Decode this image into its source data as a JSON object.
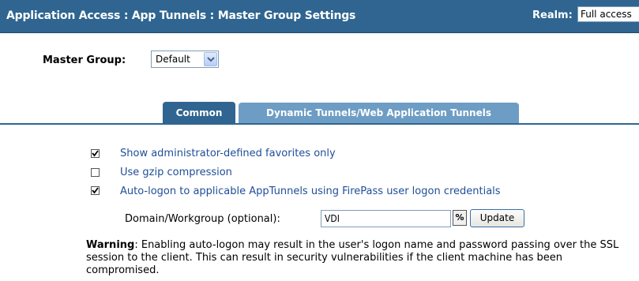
{
  "header": {
    "title": "Application Access : App Tunnels : Master Group Settings",
    "realm_label": "Realm:",
    "realm_value": "Full access"
  },
  "master_group": {
    "label": "Master Group:",
    "value": "Default"
  },
  "tabs": [
    {
      "label": "Common",
      "active": true
    },
    {
      "label": "Dynamic Tunnels/Web Application Tunnels",
      "active": false
    }
  ],
  "options": [
    {
      "label": "Show administrator-defined favorites only",
      "checked": true
    },
    {
      "label": "Use gzip compression",
      "checked": false
    },
    {
      "label": "Auto-logon to applicable AppTunnels using FirePass user logon credentials",
      "checked": true
    }
  ],
  "domain": {
    "label": "Domain/Workgroup (optional):",
    "value": "VDI",
    "percent_label": "%",
    "update_label": "Update"
  },
  "warning": {
    "prefix": "Warning",
    "text": ": Enabling auto-logon may result in the user's logon name and password passing over the SSL session to the client. This can result in security vulnerabilities if the client machine has been compromised."
  },
  "colors": {
    "header_bg": "#2f6590",
    "tab_inactive": "#6d9dc4",
    "link_text": "#1f4e99"
  }
}
